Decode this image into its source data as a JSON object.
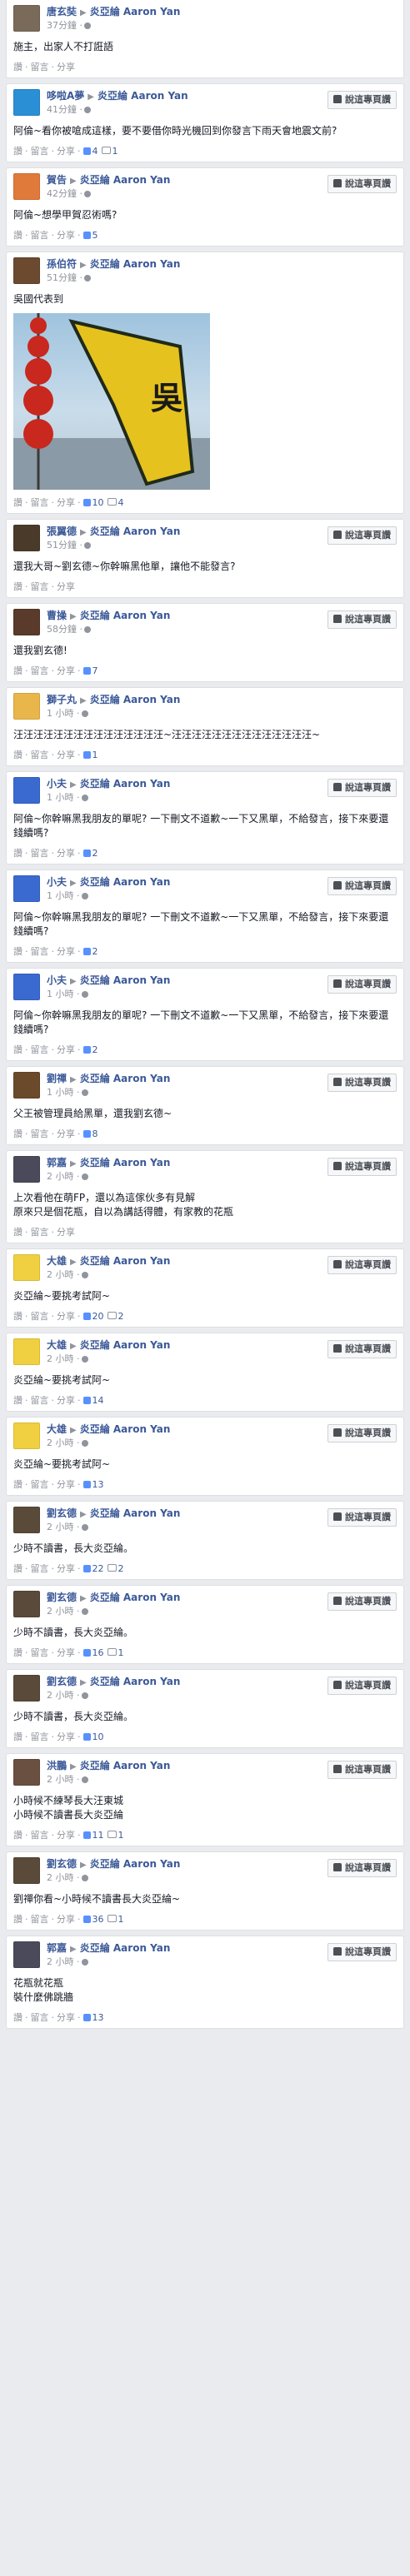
{
  "labels": {
    "arrow": "▶",
    "report": "說這專頁讚",
    "like": "讚",
    "comment": "留言",
    "share": "分享",
    "dot": "·"
  },
  "colors": {
    "link": "#3b5998",
    "muted": "#90949c",
    "like_icon": "#5890ff",
    "background": "#e9ebee"
  },
  "posts": [
    {
      "author": "唐玄奘",
      "page": "炎亞綸 Aaron Yan",
      "time": "37分鐘",
      "text": "施主，出家人不打誑語",
      "likes": "",
      "comments": "",
      "report": false,
      "avatar": "#7a6a5a"
    },
    {
      "author": "哆啦A夢",
      "page": "炎亞綸 Aaron Yan",
      "time": "41分鐘",
      "text": "阿倫~看你被嗆成這樣，要不要借你時光機回到你發言下雨天會地震文前?",
      "likes": "4",
      "comments": "1",
      "report": true,
      "avatar": "#2b8fd6"
    },
    {
      "author": "賀告",
      "page": "炎亞綸 Aaron Yan",
      "time": "42分鐘",
      "text": "阿倫~想學甲賀忍術嗎?",
      "likes": "5",
      "comments": "",
      "report": true,
      "avatar": "#e07a3a"
    },
    {
      "author": "孫伯符",
      "page": "炎亞綸 Aaron Yan",
      "time": "51分鐘",
      "text": "吳國代表到",
      "likes": "10",
      "comments": "4",
      "report": false,
      "avatar": "#6b4a30",
      "photo": true
    },
    {
      "author": "張翼德",
      "page": "炎亞綸 Aaron Yan",
      "time": "51分鐘",
      "text": "還我大哥~劉玄德~你幹嘛黑他單，讓他不能發言?",
      "likes": "",
      "comments": "",
      "report": true,
      "avatar": "#4a3a2a"
    },
    {
      "author": "曹操",
      "page": "炎亞綸 Aaron Yan",
      "time": "58分鐘",
      "text": "還我劉玄德!",
      "likes": "7",
      "comments": "",
      "report": true,
      "avatar": "#5a3a2a"
    },
    {
      "author": "獅子丸",
      "page": "炎亞綸 Aaron Yan",
      "time": "1 小時",
      "text": "汪汪汪汪汪汪汪汪汪汪汪汪汪汪汪~汪汪汪汪汪汪汪汪汪汪汪汪汪汪~",
      "likes": "1",
      "comments": "",
      "report": false,
      "avatar": "#e8b64a"
    },
    {
      "author": "小夫",
      "page": "炎亞綸 Aaron Yan",
      "time": "1 小時",
      "text": "阿倫~你幹嘛黑我朋友的單呢? 一下刪文不道歉~一下又黑單，不給發言，接下來要還錢續嗎?",
      "likes": "2",
      "comments": "",
      "report": true,
      "avatar": "#3a6ad0"
    },
    {
      "author": "小夫",
      "page": "炎亞綸 Aaron Yan",
      "time": "1 小時",
      "text": "阿倫~你幹嘛黑我朋友的單呢? 一下刪文不道歉~一下又黑單，不給發言，接下來要還錢續嗎?",
      "likes": "2",
      "comments": "",
      "report": true,
      "avatar": "#3a6ad0"
    },
    {
      "author": "小夫",
      "page": "炎亞綸 Aaron Yan",
      "time": "1 小時",
      "text": "阿倫~你幹嘛黑我朋友的單呢? 一下刪文不道歉~一下又黑單，不給發言，接下來要還錢續嗎?",
      "likes": "2",
      "comments": "",
      "report": true,
      "avatar": "#3a6ad0"
    },
    {
      "author": "劉禪",
      "page": "炎亞綸 Aaron Yan",
      "time": "1 小時",
      "text": "父王被管理員給黑單，還我劉玄德~",
      "likes": "8",
      "comments": "",
      "report": true,
      "avatar": "#6a4a2a"
    },
    {
      "author": "郭嘉",
      "page": "炎亞綸 Aaron Yan",
      "time": "2 小時",
      "text": "上次看他在萌FP，還以為這傢伙多有見解\n原來只是個花瓶，自以為講話得體，有家教的花瓶",
      "likes": "",
      "comments": "",
      "report": true,
      "avatar": "#4a4a5a"
    },
    {
      "author": "大雄",
      "page": "炎亞綸 Aaron Yan",
      "time": "2 小時",
      "text": "炎亞綸~要挑考試阿~",
      "likes": "20",
      "comments": "2",
      "report": true,
      "avatar": "#f0d040"
    },
    {
      "author": "大雄",
      "page": "炎亞綸 Aaron Yan",
      "time": "2 小時",
      "text": "炎亞綸~要挑考試阿~",
      "likes": "14",
      "comments": "",
      "report": true,
      "avatar": "#f0d040"
    },
    {
      "author": "大雄",
      "page": "炎亞綸 Aaron Yan",
      "time": "2 小時",
      "text": "炎亞綸~要挑考試阿~",
      "likes": "13",
      "comments": "",
      "report": true,
      "avatar": "#f0d040"
    },
    {
      "author": "劉玄德",
      "page": "炎亞綸 Aaron Yan",
      "time": "2 小時",
      "text": "少時不讀書，長大炎亞綸。",
      "likes": "22",
      "comments": "2",
      "report": true,
      "avatar": "#5a4a3a"
    },
    {
      "author": "劉玄德",
      "page": "炎亞綸 Aaron Yan",
      "time": "2 小時",
      "text": "少時不讀書，長大炎亞綸。",
      "likes": "16",
      "comments": "1",
      "report": true,
      "avatar": "#5a4a3a"
    },
    {
      "author": "劉玄德",
      "page": "炎亞綸 Aaron Yan",
      "time": "2 小時",
      "text": "少時不讀書，長大炎亞綸。",
      "likes": "10",
      "comments": "",
      "report": true,
      "avatar": "#5a4a3a"
    },
    {
      "author": "洪鵬",
      "page": "炎亞綸 Aaron Yan",
      "time": "2 小時",
      "text": "小時候不練琴長大汪東城\n小時候不讀書長大炎亞綸",
      "likes": "11",
      "comments": "1",
      "report": true,
      "avatar": "#6a5040"
    },
    {
      "author": "劉玄德",
      "page": "炎亞綸 Aaron Yan",
      "time": "2 小時",
      "text": "劉禪你看~小時候不讀書長大炎亞綸~",
      "likes": "36",
      "comments": "1",
      "report": true,
      "avatar": "#5a4a3a"
    },
    {
      "author": "郭嘉",
      "page": "炎亞綸 Aaron Yan",
      "time": "2 小時",
      "text": "花瓶就花瓶\n裝什麼佛跳牆",
      "likes": "13",
      "comments": "",
      "report": true,
      "avatar": "#4a4a5a"
    }
  ],
  "photo": {
    "banner_text": "吳"
  }
}
